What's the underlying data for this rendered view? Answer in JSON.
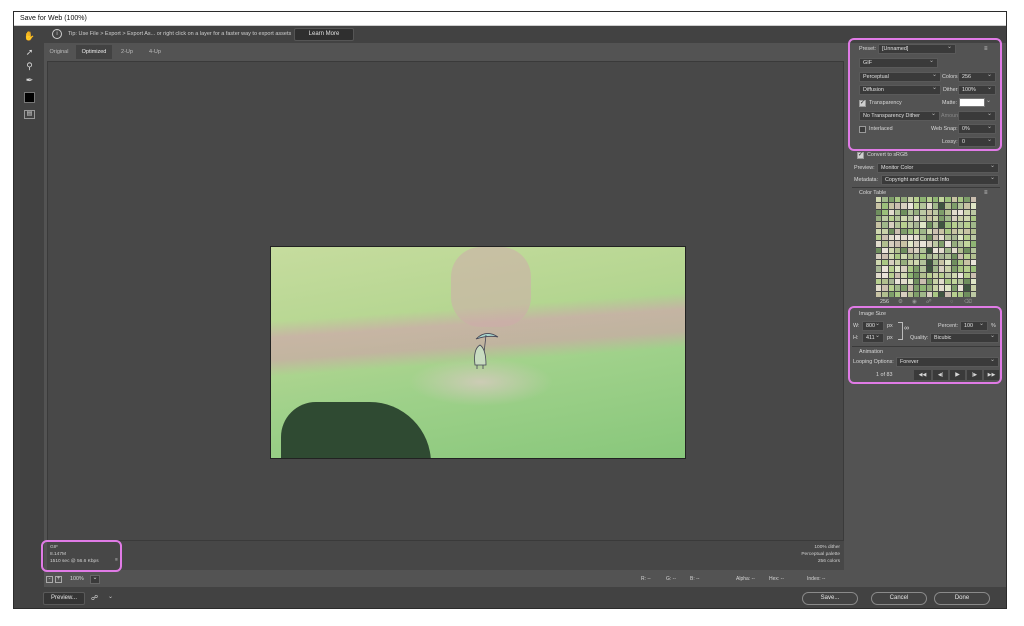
{
  "window": {
    "title": "Save for Web (100%)"
  },
  "tip": {
    "text": "Tip: Use File > Export > Export As...  or right click on a layer for a faster way to export assets",
    "learn_more": "Learn More"
  },
  "tabs": [
    "Original",
    "Optimized",
    "2-Up",
    "4-Up"
  ],
  "info_left": [
    "GIF",
    "8.147M",
    "1510 sec @ 56.6 Kbps"
  ],
  "info_left_menu": "≡",
  "info_right": [
    "100% dither",
    "Perceptual palette",
    "256 colors"
  ],
  "zoom": {
    "value": "100%"
  },
  "readouts": {
    "r": "R: --",
    "g": "G: --",
    "b": "B: --",
    "alpha": "Alpha: --",
    "hex": "Hex: --",
    "index": "Index: --"
  },
  "buttons": {
    "preview": "Preview...",
    "save": "Save...",
    "cancel": "Cancel",
    "done": "Done"
  },
  "settings": {
    "preset_label": "Preset:",
    "preset_value": "[Unnamed]",
    "format": "GIF",
    "reduction": "Perceptual",
    "colors_label": "Colors:",
    "colors_value": "256",
    "dither_algo": "Diffusion",
    "dither_label": "Dither:",
    "dither_value": "100%",
    "transparency_label": "Transparency",
    "matte_label": "Matte:",
    "transparency_dither": "No Transparency Dither",
    "amount_label": "Amount:",
    "interlaced_label": "Interlaced",
    "websnap_label": "Web Snap:",
    "websnap_value": "0%",
    "lossy_label": "Lossy:",
    "lossy_value": "0"
  },
  "convert": {
    "srgb_label": "Convert to sRGB",
    "preview_label": "Preview:",
    "preview_value": "Monitor Color",
    "metadata_label": "Metadata:",
    "metadata_value": "Copyright and Contact Info"
  },
  "color_table": {
    "title": "Color Table",
    "count": "256"
  },
  "image_size": {
    "title": "Image Size",
    "w_label": "W:",
    "w_value": "800",
    "h_label": "H:",
    "h_value": "411",
    "unit": "px",
    "percent_label": "Percent:",
    "percent_value": "100",
    "percent_unit": "%",
    "quality_label": "Quality:",
    "quality_value": "Bicubic"
  },
  "animation": {
    "title": "Animation",
    "looping_label": "Looping Options:",
    "looping_value": "Forever",
    "frame_counter": "1 of 83"
  },
  "colors": {
    "highlight": "#e07be6",
    "accent_button_border": "#8a8a8a"
  }
}
